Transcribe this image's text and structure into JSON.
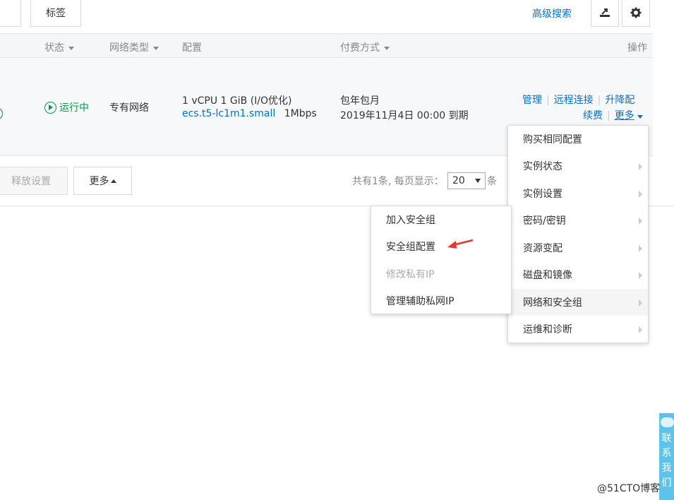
{
  "toolbar": {
    "tag_label": "标签",
    "advanced_search": "高级搜索",
    "export_icon": "export-icon",
    "settings_icon": "gear-icon"
  },
  "table": {
    "headers": {
      "status": "状态",
      "network_type": "网络类型",
      "config": "配置",
      "billing": "付费方式",
      "actions": "操作"
    },
    "row": {
      "status": "运行中",
      "network_type": "专有网络",
      "config_line1": "1 vCPU 1 GiB (I/O优化)",
      "instance_type": "ecs.t5-lc1m1.small",
      "bandwidth": "1Mbps",
      "billing_type": "包年包月",
      "expiry": "2019年11月4日 00:00 到期",
      "actions": {
        "manage": "管理",
        "remote_connect": "远程连接",
        "upgrade": "升降配",
        "renew": "续费",
        "more": "更多"
      }
    }
  },
  "bottom_bar": {
    "release_settings": "释放设置",
    "more": "更多",
    "total_text": "共有1条, 每页显示：",
    "page_size": "20",
    "unit": "条"
  },
  "main_menu": {
    "items": [
      {
        "label": "购买相同配置",
        "has_sub": false
      },
      {
        "label": "实例状态",
        "has_sub": true
      },
      {
        "label": "实例设置",
        "has_sub": true
      },
      {
        "label": "密码/密钥",
        "has_sub": true
      },
      {
        "label": "资源变配",
        "has_sub": true
      },
      {
        "label": "磁盘和镜像",
        "has_sub": true
      },
      {
        "label": "网络和安全组",
        "has_sub": true,
        "active": true
      },
      {
        "label": "运维和诊断",
        "has_sub": true
      }
    ]
  },
  "sub_menu": {
    "items": [
      {
        "label": "加入安全组"
      },
      {
        "label": "安全组配置"
      },
      {
        "label": "修改私有IP",
        "disabled": true
      },
      {
        "label": "管理辅助私网IP"
      }
    ]
  },
  "side_widget": {
    "chars": [
      "联",
      "系",
      "我",
      "们"
    ]
  },
  "watermark": "@51CTO博客",
  "colors": {
    "link": "#0070cc",
    "running": "#009a42",
    "arrow": "#e8332e",
    "side_widget": "#5ec3ea"
  }
}
